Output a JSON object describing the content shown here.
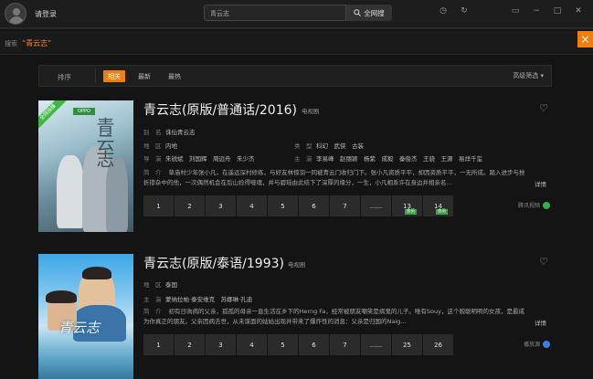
{
  "header": {
    "login_label": "请登录",
    "search_value": "青云志",
    "search_button": "全网搜",
    "icons": [
      "clock-icon",
      "refresh-icon",
      "cast-icon",
      "minimize-icon",
      "maximize-icon",
      "close-icon"
    ]
  },
  "search_row": {
    "label": "搜索",
    "keyword": "“青云志”"
  },
  "filter": {
    "sort_label": "排序",
    "tabs": [
      "相关",
      "最新",
      "最热"
    ],
    "active_tab": "相关",
    "advanced": "高级筛选 ▾"
  },
  "results": [
    {
      "title": "青云志(原版/普通话/2016)",
      "type": "电视剧",
      "poster_ribbon": "全网独播",
      "poster_brand": "OPPO",
      "poster_art": "青云志",
      "meta": [
        {
          "k": "别　名",
          "v": "诛仙青云志"
        },
        {
          "k": "地　区",
          "v": "内地"
        },
        {
          "k": "类　型",
          "v": "科幻　武侠　古装"
        },
        {
          "k": "导　演",
          "v": "朱锐斌　刘国辉　周远舟　朱少杰"
        },
        {
          "k": "主　演",
          "v": "李易峰　赵丽颖　杨紫　成毅　秦俊杰　王骁　王源　易烊千玺"
        }
      ],
      "desc_label": "简　介",
      "desc": "草庙村少年张小凡，在遥远深村修练，与好友林惊羽一同被青云门收归门下。张小凡资质平平，却因资质平平，一无所成。踏入进步与挫折掺杂中的他，一次偶然机会在后山捡得噬魂，并与碧瑶由此结下了深厚的缘分，一生，小凡相系许在身边并相亲名…",
      "detail": "详情",
      "episodes": [
        {
          "n": "1"
        },
        {
          "n": "2"
        },
        {
          "n": "3"
        },
        {
          "n": "4"
        },
        {
          "n": "5"
        },
        {
          "n": "6"
        },
        {
          "n": "7"
        },
        {
          "n": "......"
        },
        {
          "n": "13",
          "badge": "会员"
        },
        {
          "n": "14",
          "badge": "会员"
        }
      ],
      "source": "腾讯视频",
      "source_color": "#34b04a"
    },
    {
      "title": "青云志(原版/泰语/1993)",
      "type": "电视剧",
      "poster_art": "青云志",
      "meta": [
        {
          "k": "地　区",
          "v": "泰国"
        },
        {
          "k": "主　演",
          "v": "蒙纳拉帕·泰安维克　苏娜琳·孔迪"
        }
      ],
      "desc_label": "简　介",
      "desc": "初有日驹病的父亲，孤孤的母亲一直生活在乡下的Herng Fa，经常被朋友嘲笑是病鬼的儿子。唯有Souy，这个貌聪明明的女孩，是最成为你真正的朋友。父亲因病去世，从未谋面的姑姑出现并带来了爆炸性的消息：父亲是归国的Naig…",
      "detail": "详情",
      "episodes": [
        {
          "n": "1"
        },
        {
          "n": "2"
        },
        {
          "n": "3"
        },
        {
          "n": "4"
        },
        {
          "n": "5"
        },
        {
          "n": "6"
        },
        {
          "n": "7"
        },
        {
          "n": "......"
        },
        {
          "n": "25"
        },
        {
          "n": "26"
        }
      ],
      "source": "播放源",
      "source_color": "#3b7de0"
    }
  ],
  "close_label": "×"
}
